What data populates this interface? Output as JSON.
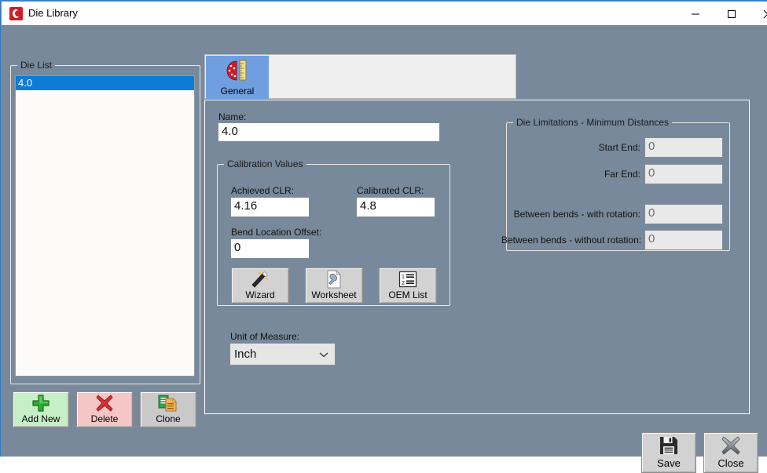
{
  "window": {
    "title": "Die Library",
    "icon": "die-app-icon",
    "controls": {
      "minimize": "minimize-icon",
      "maximize": "maximize-icon",
      "close": "close-icon"
    }
  },
  "die_list": {
    "group_title": "Die List",
    "items": [
      {
        "label": "4.0",
        "selected": true
      }
    ],
    "buttons": [
      {
        "name": "add-new",
        "label": "Add New",
        "icon": "plus-icon",
        "color": "#c6efc6"
      },
      {
        "name": "delete",
        "label": "Delete",
        "icon": "x-mark-icon",
        "color": "#f5c6c6"
      },
      {
        "name": "clone",
        "label": "Clone",
        "icon": "copy-documents-icon",
        "color": "#c9c9c9"
      }
    ]
  },
  "tabs": [
    {
      "label": "General",
      "icon": "die-ruler-icon",
      "selected": true
    }
  ],
  "general": {
    "name_label": "Name:",
    "name_value": "4.0",
    "calibration": {
      "group_title": "Calibration Values",
      "achieved_label": "Achieved CLR:",
      "achieved_value": "4.16",
      "calibrated_label": "Calibrated CLR:",
      "calibrated_value": "4.8",
      "offset_label": "Bend Location Offset:",
      "offset_value": "0",
      "buttons": [
        {
          "name": "wizard",
          "label": "Wizard",
          "icon": "magic-wand-icon"
        },
        {
          "name": "worksheet",
          "label": "Worksheet",
          "icon": "document-wrench-icon"
        },
        {
          "name": "oem-list",
          "label": "OEM List",
          "icon": "numbered-list-icon"
        }
      ]
    },
    "unit_of_measure": {
      "label": "Unit of Measure:",
      "value": "Inch",
      "chevron": "chevron-down-icon"
    },
    "limitations": {
      "group_title": "Die Limitations - Minimum Distances",
      "rows": [
        {
          "label": "Start End:",
          "value": "0",
          "disabled": true
        },
        {
          "label": "Far End:",
          "value": "0",
          "disabled": true
        },
        {
          "label": "Between bends - with rotation:",
          "value": "0",
          "disabled": true
        },
        {
          "label": "Between bends - without rotation:",
          "value": "0",
          "disabled": true
        }
      ]
    }
  },
  "footer": {
    "buttons": [
      {
        "name": "save",
        "label": "Save",
        "icon": "floppy-disk-icon"
      },
      {
        "name": "close",
        "label": "Close",
        "icon": "x-mark-gray-icon"
      }
    ]
  },
  "colors": {
    "background": "#78899c",
    "selection": "#0c7cd5",
    "tab_selected": "#6f9fe0",
    "window_border": "#2f7cc4",
    "add_new": "#c6efc6",
    "delete": "#f5c6c6"
  }
}
